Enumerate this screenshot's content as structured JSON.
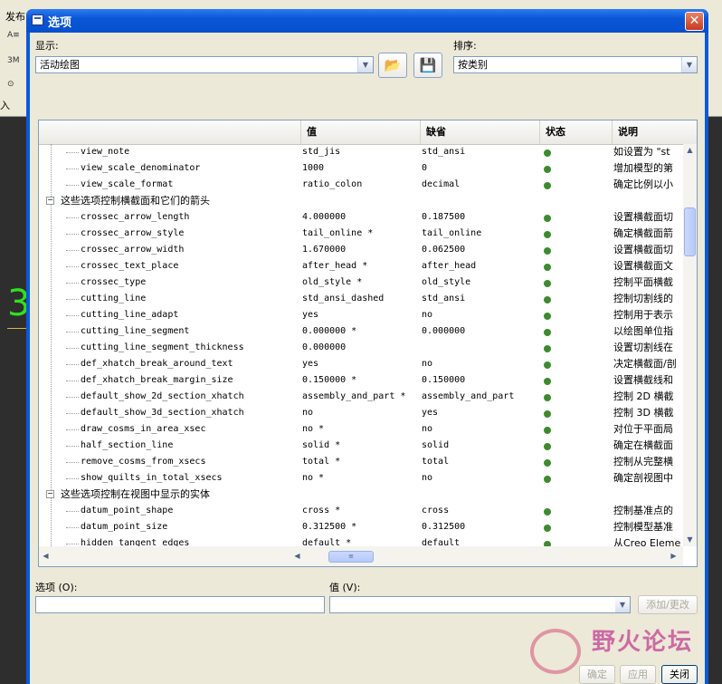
{
  "background": {
    "tab_label": "发布",
    "input_label": "入",
    "big_digit": "3"
  },
  "dialog": {
    "title": "选项",
    "close_glyph": "✕",
    "display_label": "显示:",
    "display_value": "活动绘图",
    "sort_label": "排序:",
    "sort_value": "按类别",
    "open_icon": "folder-open-icon",
    "save_icon": "save-icon"
  },
  "table": {
    "columns": [
      "值",
      "缺省",
      "状态",
      "说明"
    ],
    "rows": [
      {
        "type": "item",
        "name": "view_note",
        "value": "std_jis",
        "default": "std_ansi",
        "desc": "如设置为 \"st"
      },
      {
        "type": "item",
        "name": "view_scale_denominator",
        "value": "1000",
        "default": "0",
        "desc": "增加模型的第"
      },
      {
        "type": "item",
        "name": "view_scale_format",
        "value": "ratio_colon",
        "default": "decimal",
        "desc": "确定比例以小"
      },
      {
        "type": "group",
        "name": "这些选项控制横截面和它们的箭头"
      },
      {
        "type": "item",
        "name": "crossec_arrow_length",
        "value": "4.000000",
        "default": "0.187500",
        "desc": "设置横截面切"
      },
      {
        "type": "item",
        "name": "crossec_arrow_style",
        "value": "tail_online *",
        "default": "tail_online",
        "desc": "确定横截面箭"
      },
      {
        "type": "item",
        "name": "crossec_arrow_width",
        "value": "1.670000",
        "default": "0.062500",
        "desc": "设置横截面切"
      },
      {
        "type": "item",
        "name": "crossec_text_place",
        "value": "after_head *",
        "default": "after_head",
        "desc": "设置横截面文"
      },
      {
        "type": "item",
        "name": "crossec_type",
        "value": "old_style *",
        "default": "old_style",
        "desc": "控制平面横截"
      },
      {
        "type": "item",
        "name": "cutting_line",
        "value": "std_ansi_dashed",
        "default": "std_ansi",
        "desc": "控制切割线的"
      },
      {
        "type": "item",
        "name": "cutting_line_adapt",
        "value": "yes",
        "default": "no",
        "desc": "控制用于表示"
      },
      {
        "type": "item",
        "name": "cutting_line_segment",
        "value": "0.000000 *",
        "default": "0.000000",
        "desc": "以绘图单位指"
      },
      {
        "type": "item",
        "name": "cutting_line_segment_thickness",
        "value": "0.000000",
        "default": "",
        "desc": "设置切割线在"
      },
      {
        "type": "item",
        "name": "def_xhatch_break_around_text",
        "value": "yes",
        "default": "no",
        "desc": "决定横截面/剖"
      },
      {
        "type": "item",
        "name": "def_xhatch_break_margin_size",
        "value": "0.150000 *",
        "default": "0.150000",
        "desc": "设置横截线和"
      },
      {
        "type": "item",
        "name": "default_show_2d_section_xhatch",
        "value": "assembly_and_part *",
        "default": "assembly_and_part",
        "desc": "控制 2D 横截"
      },
      {
        "type": "item",
        "name": "default_show_3d_section_xhatch",
        "value": "no",
        "default": "yes",
        "desc": "控制 3D 横截"
      },
      {
        "type": "item",
        "name": "draw_cosms_in_area_xsec",
        "value": "no *",
        "default": "no",
        "desc": "对位于平面局"
      },
      {
        "type": "item",
        "name": "half_section_line",
        "value": "solid *",
        "default": "solid",
        "desc": "确定在横截面"
      },
      {
        "type": "item",
        "name": "remove_cosms_from_xsecs",
        "value": "total *",
        "default": "total",
        "desc": "控制从完整横"
      },
      {
        "type": "item",
        "name": "show_quilts_in_total_xsecs",
        "value": "no *",
        "default": "no",
        "desc": "确定剖视图中"
      },
      {
        "type": "group",
        "name": "这些选项控制在视图中显示的实体"
      },
      {
        "type": "item",
        "name": "datum_point_shape",
        "value": "cross *",
        "default": "cross",
        "desc": "控制基准点的"
      },
      {
        "type": "item",
        "name": "datum_point_size",
        "value": "0.312500 *",
        "default": "0.312500",
        "desc": "控制模型基准"
      },
      {
        "type": "item",
        "name": "hidden_tangent_edges",
        "value": "default *",
        "default": "default",
        "desc": "从Creo Eleme"
      }
    ]
  },
  "footer": {
    "option_label": "选项 (O):",
    "value_label": "值 (V):",
    "option_value": "",
    "value_value": "",
    "add_change_button": "添加/更改",
    "ok_button": "确定",
    "apply_button": "应用",
    "close_button": "关闭"
  },
  "watermark": {
    "text": "野火论坛"
  },
  "colors": {
    "titlebar": "#0a56d6",
    "status_dot": "#3e8a2e",
    "big_digit": "#31e01f"
  }
}
